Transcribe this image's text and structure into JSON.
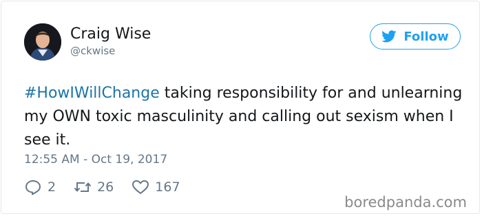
{
  "user": {
    "name": "Craig Wise",
    "handle": "@ckwise"
  },
  "follow_label": "Follow",
  "tweet": {
    "hashtag": "#HowIWillChange",
    "text": " taking responsibility for and unlearning my OWN toxic masculinity and calling out sexism when I see it.",
    "timestamp": "12:55 AM - Oct 19, 2017"
  },
  "actions": {
    "replies": "2",
    "retweets": "26",
    "likes": "167"
  },
  "watermark": "boredpanda.com",
  "colors": {
    "accent": "#1da1f2",
    "hashtag": "#1b74a8",
    "muted": "#657786",
    "text": "#14171a",
    "border": "#e1e8ed"
  }
}
